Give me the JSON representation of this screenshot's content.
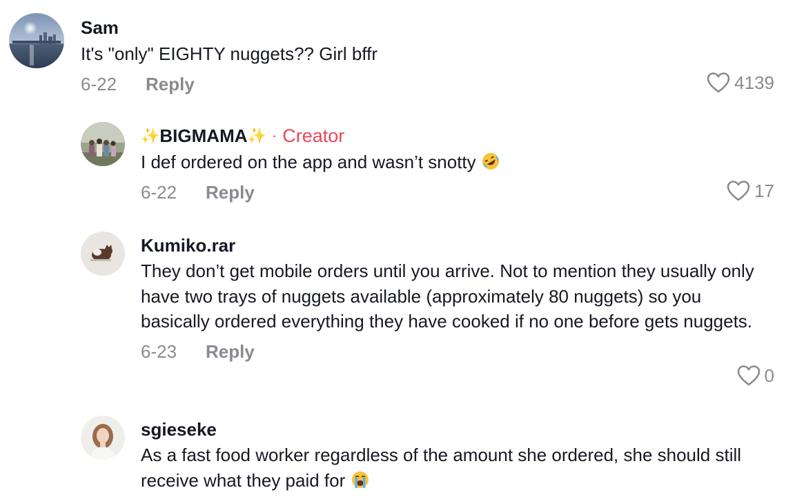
{
  "comments": [
    {
      "username": "Sam",
      "text": "It's \"only\" EIGHTY nuggets?? Girl bffr",
      "date": "6-22",
      "reply_label": "Reply",
      "likes": "4139",
      "avatar": "city-waterfront-photo"
    },
    {
      "username_prefix": "✨",
      "username": "BIGMAMA",
      "username_suffix": "✨",
      "separator": "·",
      "creator_badge": "Creator",
      "text": "I def ordered on the app and wasn’t snotty",
      "emoji": "rolling-on-floor-laughing-emoji",
      "date": "6-22",
      "reply_label": "Reply",
      "likes": "17",
      "avatar": "family-group-photo"
    },
    {
      "username": "Kumiko.rar",
      "text": "They don’t get mobile orders until you arrive. Not to mention they usually only have two trays of nuggets available (approximately 80 nuggets) so you basically ordered everything they have cooked if no one before gets nuggets.",
      "date": "6-23",
      "reply_label": "Reply",
      "likes": "0",
      "avatar": "cat-photo"
    },
    {
      "username": "sgieseke",
      "text": "As a fast food worker regardless of the amount she ordered, she should still receive what they paid for",
      "emoji": "loudly-crying-face-emoji",
      "avatar": "portrait-photo"
    }
  ],
  "colors": {
    "text": "#161823",
    "meta": "#8a8b91",
    "creator": "#e8465c"
  }
}
